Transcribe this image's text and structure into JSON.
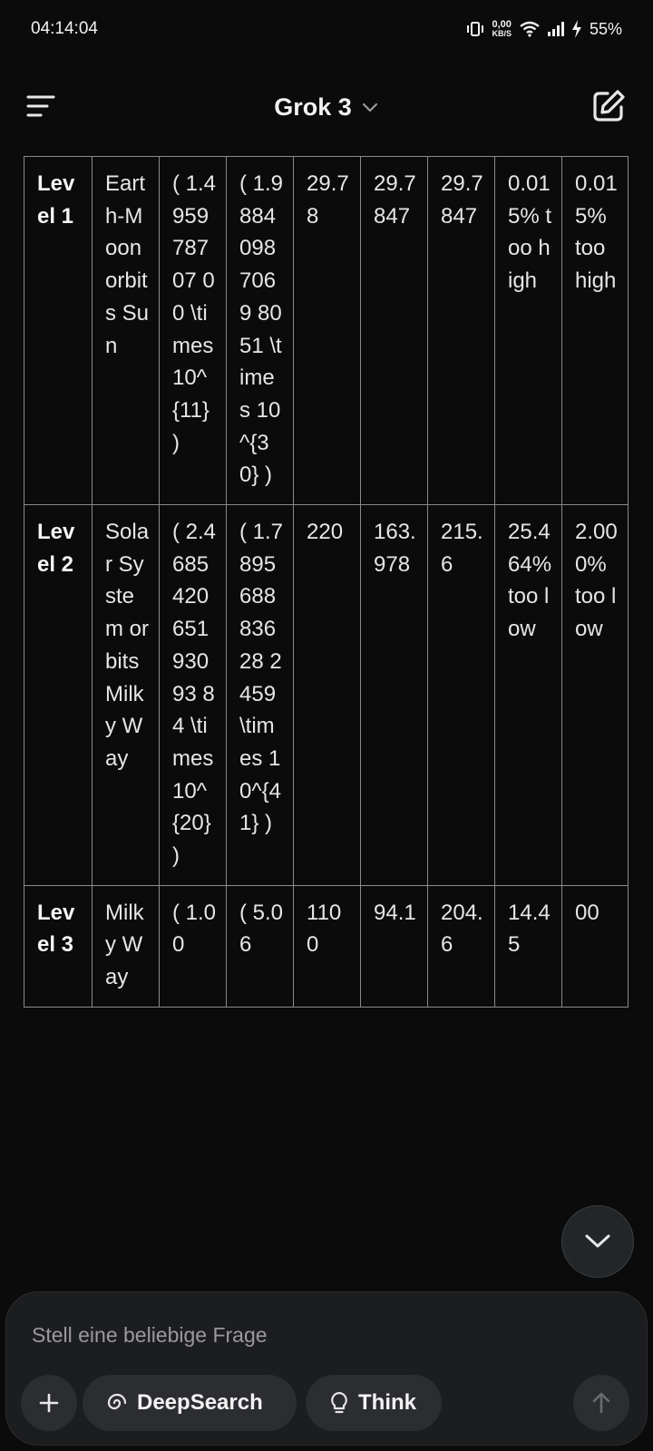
{
  "status_bar": {
    "time": "04:14:04",
    "net_speed": "0,00",
    "net_unit": "KB/S",
    "battery": "55%"
  },
  "app_bar": {
    "title": "Grok 3"
  },
  "table": {
    "prev_row_fragment": ")",
    "rows": [
      {
        "level": "Level 1",
        "system": "Earth-Moon orbits Sun",
        "distance": "( 1.495978707 00 \\times 10^{11} )",
        "mass": "( 1.98840987069 8051 \\times 10^{30} )",
        "v1": "29.78",
        "v2": "29.7847",
        "v3": "29.7847",
        "err1": "0.015% too high",
        "err2": "0.015% too high"
      },
      {
        "level": "Level 2",
        "system": "Solar System orbits Milky Way",
        "distance": "( 2.468542065193093 84 \\times 10^{20} )",
        "mass": "( 1.789568883628 2459 \\times 10^{41} )",
        "v1": "220",
        "v2": "163.978",
        "v3": "215.6",
        "err1": "25.464% too low",
        "err2": "2.000% too low"
      },
      {
        "level": "Level 3",
        "system": "Milky Way",
        "distance": "( 1.00",
        "mass": "( 5.06",
        "v1": "1100",
        "v2": "94.1",
        "v3": "204.6",
        "err1": "14.45",
        "err2": "00"
      }
    ]
  },
  "composer": {
    "placeholder": "Stell eine beliebige Frage",
    "deepsearch_label": "DeepSearch",
    "think_label": "Think"
  },
  "icons": {
    "menu": "menu-icon",
    "chevron": "chevron-down-icon",
    "edit": "edit-icon",
    "scroll_down": "chevron-down-icon",
    "plus": "plus-icon",
    "deepsearch": "deepsearch-icon",
    "think": "lightbulb-icon",
    "send": "arrow-up-icon"
  }
}
